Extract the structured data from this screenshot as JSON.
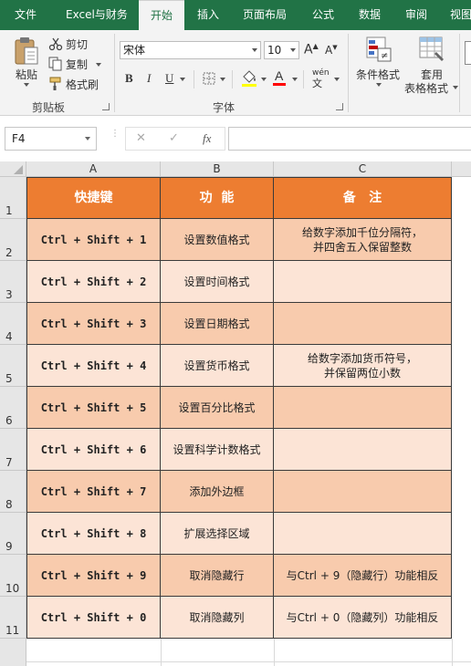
{
  "menu": {
    "tabs": [
      "文件",
      "Excel与财务",
      "开始",
      "插入",
      "页面布局",
      "公式",
      "数据",
      "审阅",
      "视图"
    ],
    "active_tab": "开始"
  },
  "ribbon": {
    "clipboard": {
      "paste": "粘贴",
      "cut": "剪切",
      "copy": "复制",
      "format_painter": "格式刷",
      "label": "剪贴板"
    },
    "font": {
      "name": "宋体",
      "size": "10",
      "bold": "B",
      "italic": "I",
      "underline": "U",
      "pinyin": "wén",
      "label": "字体"
    },
    "styles": {
      "conditional_format": "条件格式",
      "table_format_line1": "套用",
      "table_format_line2": "表格格式"
    }
  },
  "formula_bar": {
    "name_box": "F4",
    "cancel": "✕",
    "enter": "✓",
    "fx": "fx",
    "formula": ""
  },
  "sheet": {
    "columns": [
      "A",
      "B",
      "C"
    ],
    "rows": [
      "1",
      "2",
      "3",
      "4",
      "5",
      "6",
      "7",
      "8",
      "9",
      "10",
      "11"
    ],
    "headers": [
      "快捷键",
      "功  能",
      "备   注"
    ],
    "data": [
      [
        "Ctrl + Shift + 1",
        "设置数值格式",
        "给数字添加千位分隔符，\n并四舍五入保留整数"
      ],
      [
        "Ctrl + Shift + 2",
        "设置时间格式",
        ""
      ],
      [
        "Ctrl + Shift + 3",
        "设置日期格式",
        ""
      ],
      [
        "Ctrl + Shift + 4",
        "设置货币格式",
        "给数字添加货币符号，\n并保留两位小数"
      ],
      [
        "Ctrl + Shift + 5",
        "设置百分比格式",
        ""
      ],
      [
        "Ctrl + Shift + 6",
        "设置科学计数格式",
        ""
      ],
      [
        "Ctrl + Shift + 7",
        "添加外边框",
        ""
      ],
      [
        "Ctrl + Shift + 8",
        "扩展选择区域",
        ""
      ],
      [
        "Ctrl + Shift + 9",
        "取消隐藏行",
        "与Ctrl + 9（隐藏行）功能相反"
      ],
      [
        "Ctrl + Shift + 0",
        "取消隐藏列",
        "与Ctrl + 0（隐藏列）功能相反"
      ]
    ]
  },
  "colors": {
    "excel_green": "#217346",
    "header_fill": "#ed7d31",
    "dark_row_fill": "#f8cbad",
    "light_row_fill": "#fce4d6"
  }
}
